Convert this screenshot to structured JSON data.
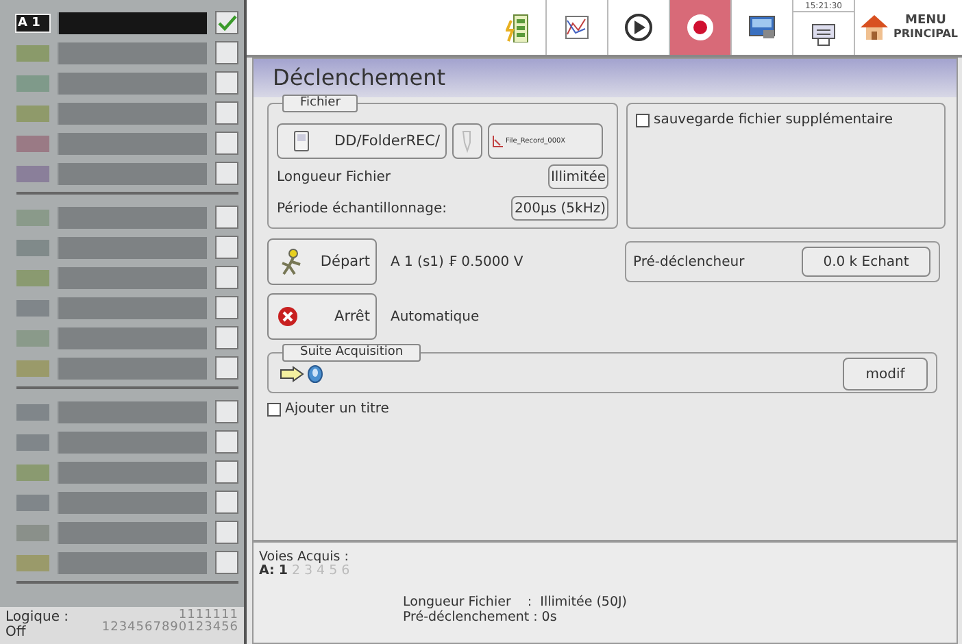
{
  "sidebar": {
    "groups": [
      {
        "channels": [
          {
            "label": "A 1",
            "active": true,
            "checked": true,
            "color": "#1a1a1a"
          },
          {
            "active": false,
            "checked": false,
            "color": "#8a9a6a"
          },
          {
            "active": false,
            "checked": false,
            "color": "#7f9a8a"
          },
          {
            "active": false,
            "checked": false,
            "color": "#8f9a6a"
          },
          {
            "active": false,
            "checked": false,
            "color": "#9a7a85"
          },
          {
            "active": false,
            "checked": false,
            "color": "#8a7f9a"
          }
        ]
      },
      {
        "channels": [
          {
            "active": false,
            "checked": false,
            "color": "#8a9a8a"
          },
          {
            "active": false,
            "checked": false,
            "color": "#808a8a"
          },
          {
            "active": false,
            "checked": false,
            "color": "#8a9a70"
          },
          {
            "active": false,
            "checked": false,
            "color": "#80868a"
          },
          {
            "active": false,
            "checked": false,
            "color": "#8a9a8a"
          },
          {
            "active": false,
            "checked": false,
            "color": "#9a9a6a"
          }
        ]
      },
      {
        "channels": [
          {
            "active": false,
            "checked": false,
            "color": "#80868a"
          },
          {
            "active": false,
            "checked": false,
            "color": "#80868a"
          },
          {
            "active": false,
            "checked": false,
            "color": "#8a9a70"
          },
          {
            "active": false,
            "checked": false,
            "color": "#80868a"
          },
          {
            "active": false,
            "checked": false,
            "color": "#8a908a"
          },
          {
            "active": false,
            "checked": false,
            "color": "#9a9a6a"
          }
        ]
      }
    ],
    "logic": {
      "label": "Logique :",
      "state": "Off",
      "tens": "1111111",
      "units": "1234567890123456"
    }
  },
  "toolbar": {
    "time": "15:21:30",
    "menu": [
      "MENU",
      "PRINCIPAL"
    ],
    "buttons": [
      {
        "kind": "battery",
        "selected": false
      },
      {
        "kind": "graph",
        "selected": false
      },
      {
        "kind": "play",
        "selected": false
      },
      {
        "kind": "record",
        "selected": true
      },
      {
        "kind": "screen",
        "selected": false
      },
      {
        "kind": "network",
        "selected": false
      }
    ]
  },
  "title": "Déclenchement",
  "file_group": {
    "legend": "Fichier",
    "folder": "DD/FolderREC/",
    "file_name": "File_Record_000X",
    "length_label": "Longueur Fichier",
    "length_value": "Illimitée",
    "period_label": "Période échantillonnage:",
    "period_value": "200µs (5kHz)"
  },
  "extra_save": {
    "label": "sauvegarde fichier supplémentaire",
    "checked": false
  },
  "start": {
    "button": "Départ",
    "condition": "A 1  (s1) ₣ 0.5000 V"
  },
  "pretrigger": {
    "label": "Pré-déclencheur",
    "value": "0.0 k Echant"
  },
  "stop": {
    "button": "Arrêt",
    "condition": "Automatique"
  },
  "next_acquisition": {
    "legend": "Suite Acquisition",
    "button": "modif"
  },
  "add_title": {
    "label": "Ajouter un titre",
    "checked": false
  },
  "summary": {
    "channels_label": "Voies Acquis :",
    "prefix": "A:",
    "channels": [
      {
        "number": "1",
        "acquired": true
      },
      {
        "number": "2",
        "acquired": false
      },
      {
        "number": "3",
        "acquired": false
      },
      {
        "number": "4",
        "acquired": false
      },
      {
        "number": "5",
        "acquired": false
      },
      {
        "number": "6",
        "acquired": false
      }
    ],
    "lines": [
      "Longueur Fichier    :  Illimitée (50J)",
      "Pré-déclenchement : 0s"
    ]
  }
}
